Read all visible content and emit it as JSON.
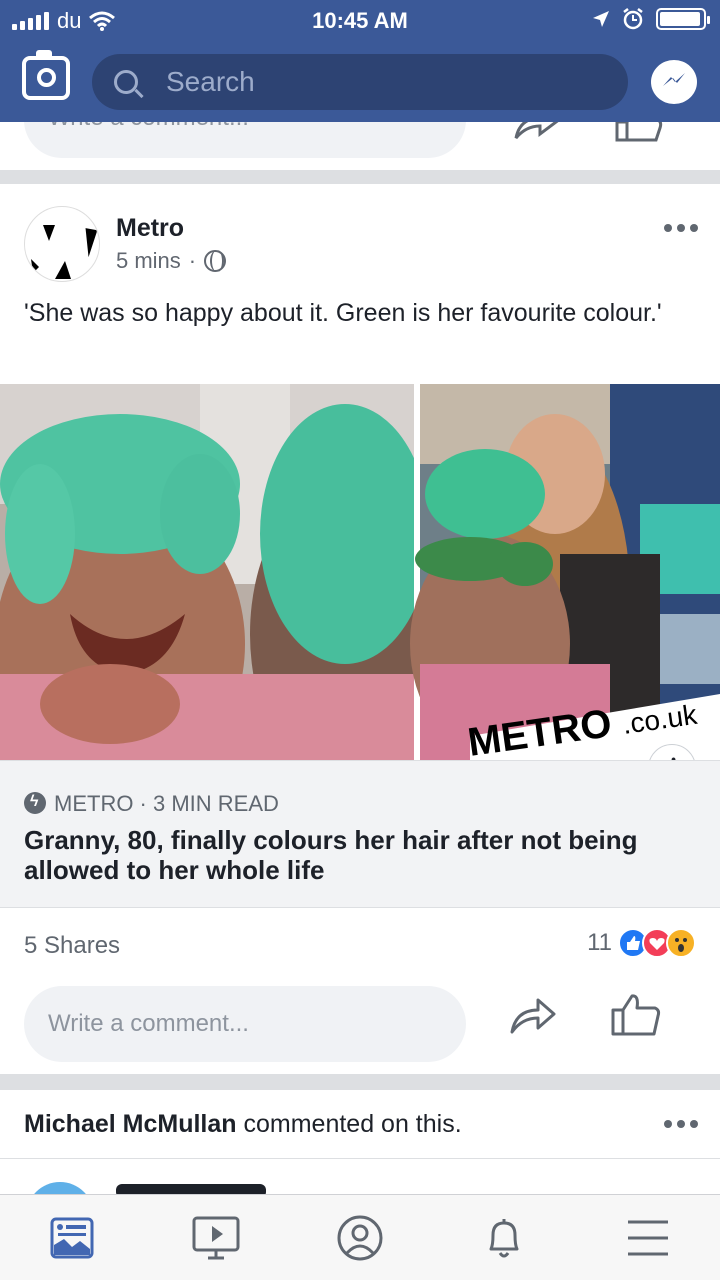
{
  "status_bar": {
    "carrier": "du",
    "time": "10:45 AM",
    "battery_level": 0.95
  },
  "nav": {
    "search_placeholder": "Search",
    "prev_comment_placeholder": "Write a comment..."
  },
  "post": {
    "author": "Metro",
    "time": "5 mins",
    "separator": "·",
    "text": "'She was so happy about it. Green is her favourite colour.'",
    "image_watermark": "METRO",
    "image_watermark_suffix": ".co.uk",
    "link": {
      "source": "METRO · 3 MIN READ",
      "title": "Granny, 80, finally colours her hair after not being allowed to her whole life"
    },
    "info_icon_label": "i",
    "shares": "5 Shares",
    "reaction_count": "11",
    "reactions": [
      "like",
      "love",
      "wow"
    ],
    "comment_placeholder": "Write a comment..."
  },
  "next_post": {
    "author": "Michael McMullan",
    "action": " commented on this."
  },
  "tabs": [
    "news-feed",
    "watch",
    "profile",
    "notifications",
    "menu"
  ],
  "colors": {
    "brand": "#3b5998",
    "search_bg": "#2d4373",
    "like": "#2078f4",
    "love": "#f33e58",
    "wow": "#f7b125",
    "active_tab": "#4267b2"
  }
}
